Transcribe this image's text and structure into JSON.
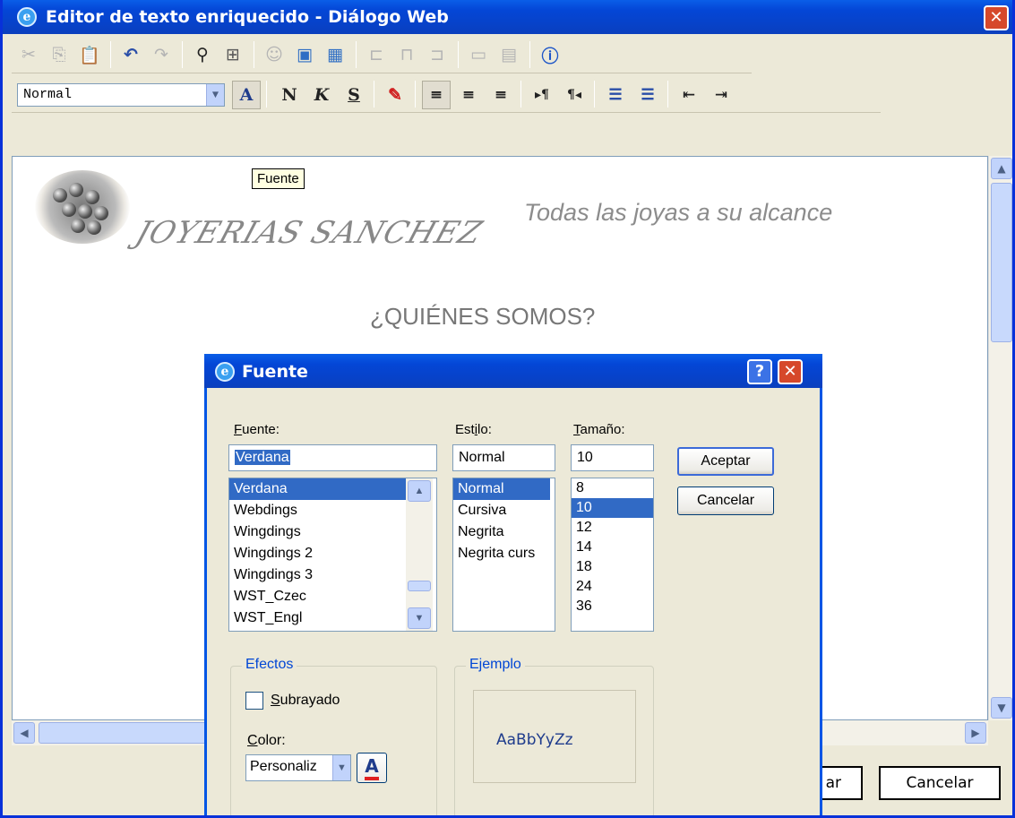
{
  "window": {
    "title": "Editor de texto enriquecido - Diálogo Web",
    "close_glyph": "✕"
  },
  "toolbar1": {
    "icons": [
      "cut-icon",
      "copy-icon",
      "paste-icon",
      "undo-icon",
      "redo-icon",
      "find-icon",
      "select-all-icon",
      "insert-user-icon",
      "insert-image-icon",
      "insert-table-icon",
      "table-row-icon",
      "table-col-icon",
      "table-cell-icon",
      "table-split-icon",
      "table-merge-icon",
      "help-icon"
    ]
  },
  "toolbar2": {
    "style_value": "Normal",
    "font_glyph": "A",
    "bold": "N",
    "italic": "K",
    "underline": "S",
    "tooltip": "Fuente"
  },
  "document": {
    "logo_text": "JOYERIAS SANCHEZ",
    "slogan": "Todas las joyas a su alcance",
    "heading": "¿QUIÉNES SOMOS?"
  },
  "footer": {
    "accept_partial": "ar",
    "cancel": "Cancelar"
  },
  "font_dialog": {
    "title": "Fuente",
    "help_glyph": "?",
    "close_glyph": "✕",
    "font_label_u": "F",
    "font_label_rest": "uente:",
    "style_label_pre": "Est",
    "style_label_u": "i",
    "style_label_rest": "lo:",
    "size_label_u": "T",
    "size_label_rest": "amaño:",
    "font_value": "Verdana",
    "style_value": "Normal",
    "size_value": "10",
    "fonts": [
      "Verdana",
      "Webdings",
      "Wingdings",
      "Wingdings 2",
      "Wingdings 3",
      "WST_Czec",
      "WST_Engl"
    ],
    "styles": [
      "Normal",
      "Cursiva",
      "Negrita",
      "Negrita curs"
    ],
    "sizes": [
      "8",
      "10",
      "12",
      "14",
      "18",
      "24",
      "36"
    ],
    "accept": "Aceptar",
    "cancel": "Cancelar",
    "effects_label": "Efectos",
    "underline_u": "S",
    "underline_rest": "ubrayado",
    "color_label_u": "C",
    "color_label_rest": "olor:",
    "color_value": "Personaliz",
    "color_button_glyph": "A",
    "sample_label": "Ejemplo",
    "sample_text": "AaBbYyZz"
  },
  "colors": {
    "title_blue": "#0a5ee8",
    "selection": "#316ac5",
    "sample_text": "#1f3c8c"
  }
}
